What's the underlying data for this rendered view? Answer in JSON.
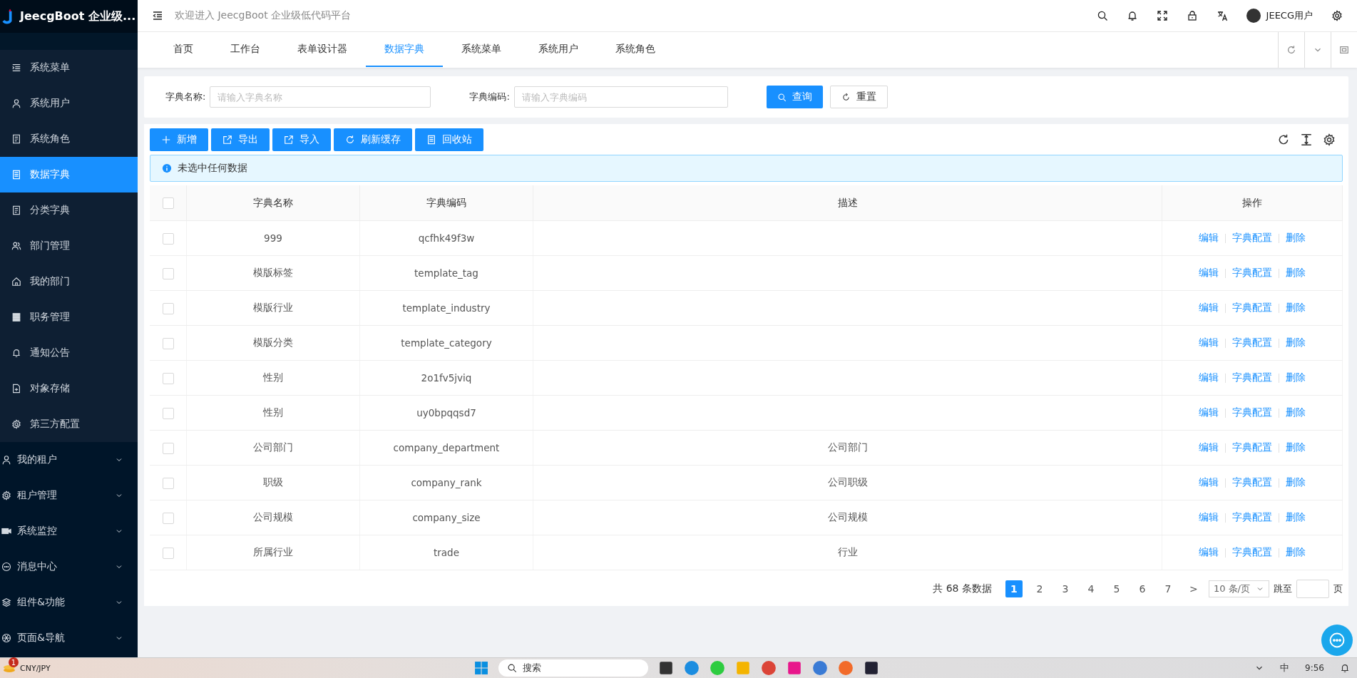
{
  "app": {
    "logo_text": "JeecgBoot 企业级...",
    "welcome": "欢迎进入 JeecgBoot 企业级低代码平台",
    "user": "JEECG用户"
  },
  "sidebar": {
    "sub_items": [
      {
        "label": "系统菜单",
        "selected": false
      },
      {
        "label": "系统用户",
        "selected": false
      },
      {
        "label": "系统角色",
        "selected": false
      },
      {
        "label": "数据字典",
        "selected": true
      },
      {
        "label": "分类字典",
        "selected": false
      },
      {
        "label": "部门管理",
        "selected": false
      },
      {
        "label": "我的部门",
        "selected": false
      },
      {
        "label": "职务管理",
        "selected": false
      },
      {
        "label": "通知公告",
        "selected": false
      },
      {
        "label": "对象存储",
        "selected": false
      },
      {
        "label": "第三方配置",
        "selected": false
      }
    ],
    "groups": [
      {
        "label": "我的租户",
        "expanded": false
      },
      {
        "label": "租户管理",
        "expanded": false
      },
      {
        "label": "系统监控",
        "expanded": false
      },
      {
        "label": "消息中心",
        "expanded": false
      },
      {
        "label": "组件&功能",
        "expanded": false
      },
      {
        "label": "页面&导航",
        "expanded": false
      }
    ]
  },
  "tabs": [
    {
      "label": "首页",
      "selected": false
    },
    {
      "label": "工作台",
      "selected": false
    },
    {
      "label": "表单设计器",
      "selected": false
    },
    {
      "label": "数据字典",
      "selected": true
    },
    {
      "label": "系统菜单",
      "selected": false
    },
    {
      "label": "系统用户",
      "selected": false
    },
    {
      "label": "系统角色",
      "selected": false
    }
  ],
  "search": {
    "fields": [
      {
        "label": "字典名称:",
        "placeholder": "请输入字典名称"
      },
      {
        "label": "字典编码:",
        "placeholder": "请输入字典编码"
      }
    ],
    "buttons": [
      {
        "label": "查询",
        "kind": "primary"
      },
      {
        "label": "重置",
        "kind": "default"
      }
    ]
  },
  "toolbar": {
    "buttons": [
      "新增",
      "导出",
      "导入",
      "刷新缓存",
      "回收站"
    ]
  },
  "alert": "未选中任何数据",
  "table": {
    "all_checked": false,
    "columns": [
      "字典名称",
      "字典编码",
      "描述",
      "操作"
    ],
    "rows": [
      {
        "checked": false,
        "name": "999",
        "code": "qcfhk49f3w",
        "description": "",
        "actions": [
          "编辑",
          "字典配置",
          "删除"
        ]
      },
      {
        "checked": false,
        "name": "模版标签",
        "code": "template_tag",
        "description": "",
        "actions": [
          "编辑",
          "字典配置",
          "删除"
        ]
      },
      {
        "checked": false,
        "name": "模版行业",
        "code": "template_industry",
        "description": "",
        "actions": [
          "编辑",
          "字典配置",
          "删除"
        ]
      },
      {
        "checked": false,
        "name": "模版分类",
        "code": "template_category",
        "description": "",
        "actions": [
          "编辑",
          "字典配置",
          "删除"
        ]
      },
      {
        "checked": false,
        "name": "性别",
        "code": "2o1fv5jviq",
        "description": "",
        "actions": [
          "编辑",
          "字典配置",
          "删除"
        ]
      },
      {
        "checked": false,
        "name": "性别",
        "code": "uy0bpqqsd7",
        "description": "",
        "actions": [
          "编辑",
          "字典配置",
          "删除"
        ]
      },
      {
        "checked": false,
        "name": "公司部门",
        "code": "company_department",
        "description": "公司部门",
        "actions": [
          "编辑",
          "字典配置",
          "删除"
        ]
      },
      {
        "checked": false,
        "name": "职级",
        "code": "company_rank",
        "description": "公司职级",
        "actions": [
          "编辑",
          "字典配置",
          "删除"
        ]
      },
      {
        "checked": false,
        "name": "公司规模",
        "code": "company_size",
        "description": "公司规模",
        "actions": [
          "编辑",
          "字典配置",
          "删除"
        ]
      },
      {
        "checked": false,
        "name": "所属行业",
        "code": "trade",
        "description": "行业",
        "actions": [
          "编辑",
          "字典配置",
          "删除"
        ]
      }
    ]
  },
  "pagination": {
    "total": "共 68 条数据",
    "pages": [
      {
        "label": "1",
        "selected": true
      },
      {
        "label": "2",
        "selected": false
      },
      {
        "label": "3",
        "selected": false
      },
      {
        "label": "4",
        "selected": false
      },
      {
        "label": "5",
        "selected": false
      },
      {
        "label": "6",
        "selected": false
      },
      {
        "label": "7",
        "selected": false
      }
    ],
    "next": ">",
    "page_size": "10 条/页",
    "jump_label": "跳至",
    "page_unit": "页"
  },
  "taskbar": {
    "badge": "1",
    "ticker": "CNY/JPY",
    "search": "搜索",
    "ime": "中",
    "time": "9:56"
  }
}
